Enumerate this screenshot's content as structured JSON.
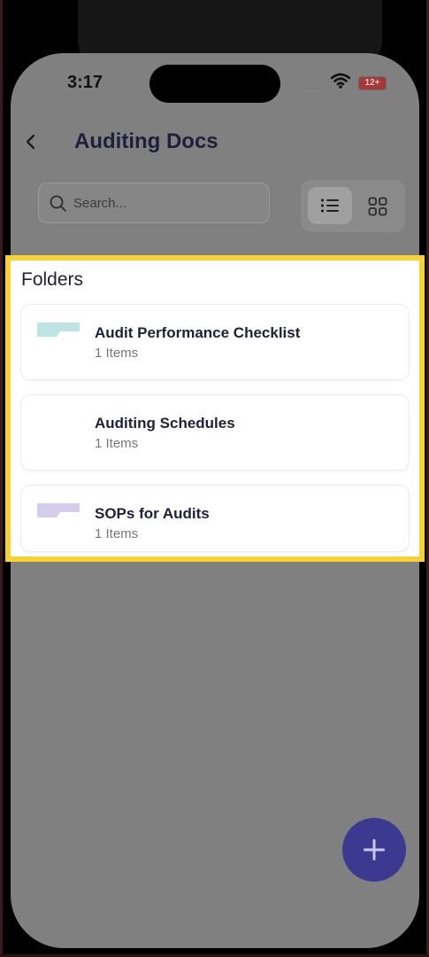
{
  "status_bar": {
    "time": "3:17",
    "signal": "....",
    "battery": "12+"
  },
  "header": {
    "title": "Auditing Docs",
    "back_icon": "back-chevron-icon"
  },
  "search": {
    "placeholder": "Search..."
  },
  "view_toggle": {
    "active": "list",
    "options": [
      "list",
      "grid"
    ]
  },
  "folders": {
    "heading": "Folders",
    "items": [
      {
        "name": "Audit Performance Checklist",
        "count": "1 Items",
        "icon_color": "#bfe3e1"
      },
      {
        "name": "Auditing Schedules",
        "count": "1 Items",
        "icon_color": ""
      },
      {
        "name": "SOPs for Audits",
        "count": "1 Items",
        "icon_color": "#d6cdea"
      }
    ]
  },
  "fab": {
    "icon": "plus-icon"
  },
  "colors": {
    "highlight": "#f8d232",
    "fab": "#3c3a90",
    "overlay": "#808080"
  }
}
